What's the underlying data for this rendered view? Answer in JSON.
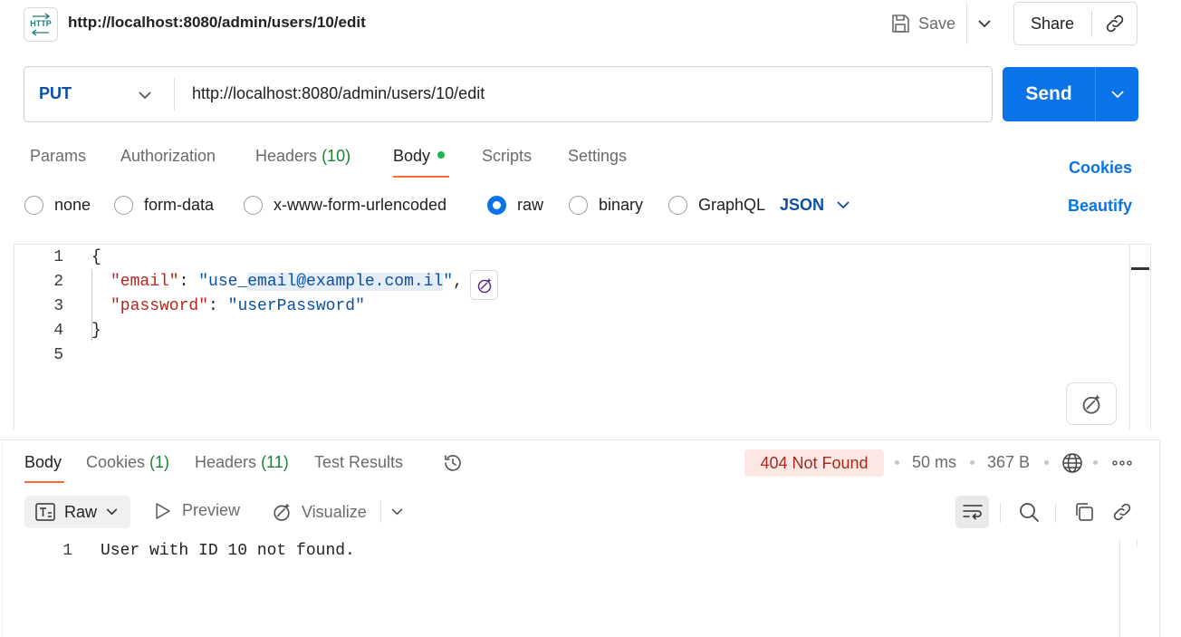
{
  "header": {
    "icon_text": "HTTP",
    "title": "http://localhost:8080/admin/users/10/edit",
    "save_label": "Save",
    "share_label": "Share"
  },
  "request": {
    "method": "PUT",
    "url": "http://localhost:8080/admin/users/10/edit",
    "send_label": "Send"
  },
  "tabs": [
    {
      "label": "Params"
    },
    {
      "label": "Authorization"
    },
    {
      "label": "Headers",
      "count": "(10)"
    },
    {
      "label": "Body"
    },
    {
      "label": "Scripts"
    },
    {
      "label": "Settings"
    }
  ],
  "links": {
    "cookies": "Cookies",
    "beautify": "Beautify"
  },
  "body_types": [
    "none",
    "form-data",
    "x-www-form-urlencoded",
    "raw",
    "binary",
    "GraphQL"
  ],
  "body_type_selected": "raw",
  "body_format": "JSON",
  "editor": {
    "line_numbers": [
      "1",
      "2",
      "3",
      "4",
      "5"
    ],
    "open_brace": "{",
    "close_brace": "}",
    "email_key": "\"email\"",
    "email_value_prefix": "\"use_",
    "email_value_selected": "email@example.com.il",
    "email_value_suffix": "\"",
    "password_key": "\"password\"",
    "password_value": "\"userPassword\"",
    "colon": ": ",
    "comma": ","
  },
  "response": {
    "tabs": [
      {
        "label": "Body"
      },
      {
        "label": "Cookies",
        "count": "(1)"
      },
      {
        "label": "Headers",
        "count": "(11)"
      },
      {
        "label": "Test Results"
      }
    ],
    "status": "404 Not Found",
    "time": "50 ms",
    "size": "367 B",
    "format": "Raw",
    "preview_label": "Preview",
    "visualize_label": "Visualize",
    "line_number": "1",
    "text": "User with ID 10 not found."
  },
  "colors": {
    "accent": "#0a73e8",
    "tab_underline": "#ff6c37",
    "status_bg": "#fde7e5",
    "status_text": "#a42a1c",
    "count_green": "#1a7f37"
  }
}
